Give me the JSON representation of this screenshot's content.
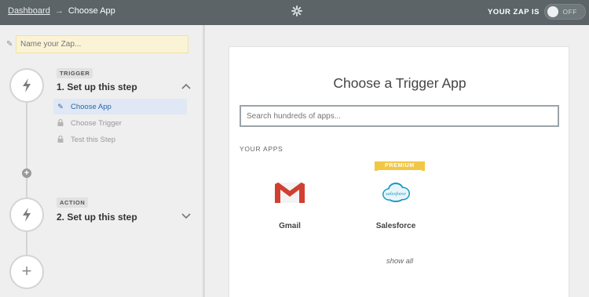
{
  "topbar": {
    "breadcrumb_link": "Dashboard",
    "breadcrumb_arrow": "→",
    "breadcrumb_current": "Choose App",
    "zap_status_label": "YOUR ZAP IS",
    "toggle_label": "OFF",
    "toggle_on": false
  },
  "sidebar": {
    "zap_name_placeholder": "Name your Zap...",
    "trigger": {
      "badge": "TRIGGER",
      "title": "1. Set up this step",
      "icon": "bolt-icon",
      "expanded": true,
      "substeps": [
        {
          "label": "Choose App",
          "icon": "pencil-icon",
          "active": true
        },
        {
          "label": "Choose Trigger",
          "icon": "lock-icon",
          "active": false
        },
        {
          "label": "Test this Step",
          "icon": "lock-icon",
          "active": false
        }
      ]
    },
    "action": {
      "badge": "ACTION",
      "title": "2. Set up this step",
      "icon": "bolt-icon",
      "expanded": false
    }
  },
  "main": {
    "title": "Choose a Trigger App",
    "search_placeholder": "Search hundreds of apps...",
    "section_label": "YOUR APPS",
    "apps": [
      {
        "name": "Gmail",
        "icon": "gmail-icon",
        "premium": false
      },
      {
        "name": "Salesforce",
        "icon": "salesforce-icon",
        "premium": true,
        "premium_label": "PREMIUM",
        "logo_text": "salesforce"
      }
    ],
    "show_all": "show all"
  },
  "colors": {
    "topbar": "#5c6467",
    "active_substep_bg": "#dfe8f4",
    "active_substep_text": "#2e64a8",
    "premium": "#f2c744",
    "gmail_red": "#d23f31",
    "salesforce_blue": "#1798c1"
  }
}
